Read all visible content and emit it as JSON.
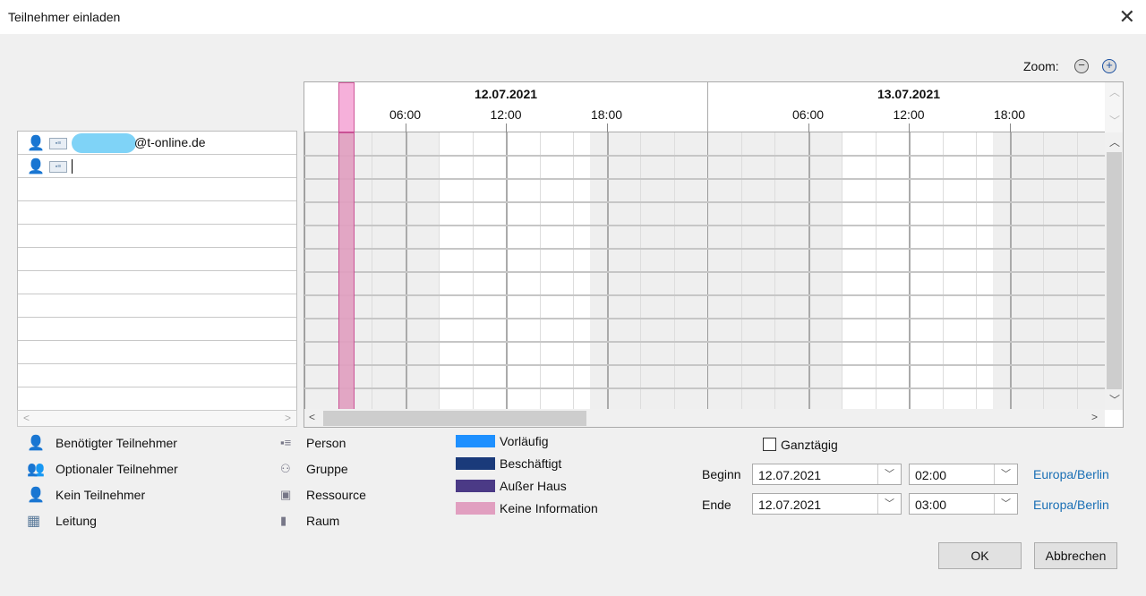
{
  "window": {
    "title": "Teilnehmer einladen"
  },
  "zoom": {
    "label": "Zoom:",
    "minus": "−",
    "plus": "+"
  },
  "participants": [
    {
      "type": "required",
      "text": "@t-online.de"
    },
    {
      "type": "required",
      "text": ""
    }
  ],
  "timeline": {
    "days": [
      "12.07.2021",
      "13.07.2021"
    ],
    "hours": [
      "06:00",
      "12:00",
      "18:00"
    ],
    "busy": [
      {
        "day": 0,
        "start": 2,
        "end": 3,
        "status": "Keine Information"
      }
    ],
    "work_start": 8,
    "work_end": 17
  },
  "legend": {
    "roles": [
      "Benötigter Teilnehmer",
      "Optionaler Teilnehmer",
      "Kein Teilnehmer",
      "Leitung"
    ],
    "types": [
      "Person",
      "Gruppe",
      "Ressource",
      "Raum"
    ],
    "status": [
      {
        "label": "Vorläufig",
        "color": "#1e90ff"
      },
      {
        "label": "Beschäftigt",
        "color": "#1a3a7a"
      },
      {
        "label": "Außer Haus",
        "color": "#4b3a86"
      },
      {
        "label": "Keine Information",
        "color": "#e19fc0"
      }
    ]
  },
  "allday": {
    "label": "Ganztägig",
    "checked": false
  },
  "begin": {
    "label": "Beginn",
    "date": "12.07.2021",
    "time": "02:00",
    "tz": "Europa/Berlin"
  },
  "end": {
    "label": "Ende",
    "date": "12.07.2021",
    "time": "03:00",
    "tz": "Europa/Berlin"
  },
  "buttons": {
    "ok": "OK",
    "cancel": "Abbrechen"
  }
}
